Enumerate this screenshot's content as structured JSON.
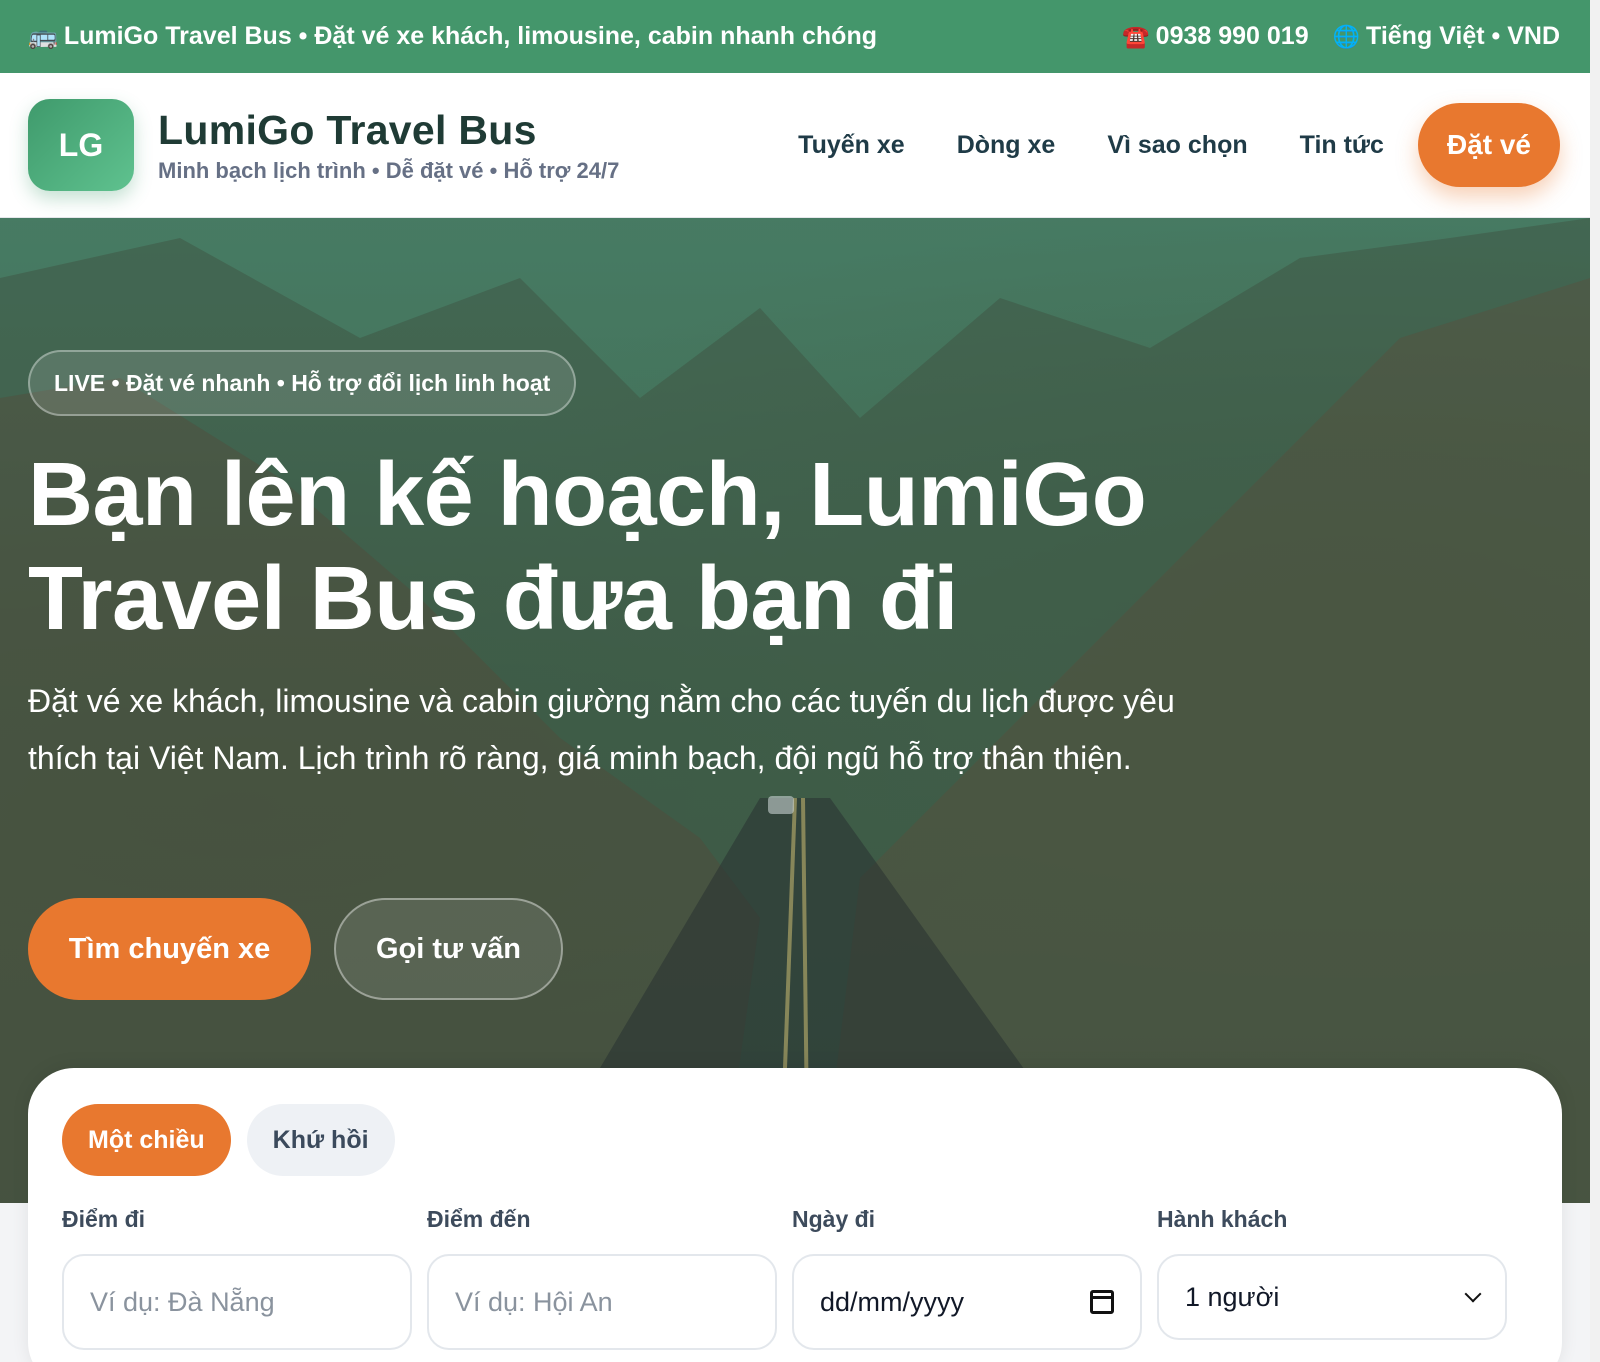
{
  "topbar": {
    "brand_text": "LumiGo Travel Bus • Đặt vé xe khách, limousine, cabin nhanh chóng",
    "bus_icon": "🚌",
    "phone_icon": "☎️",
    "phone": "0938 990 019",
    "globe_icon": "🌐",
    "locale": "Tiếng Việt • VND"
  },
  "header": {
    "logo_text": "LG",
    "brand_name": "LumiGo Travel Bus",
    "tagline": "Minh bạch lịch trình • Dễ đặt vé • Hỗ trợ 24/7",
    "nav": [
      "Tuyến xe",
      "Dòng xe",
      "Vì sao chọn",
      "Tin tức"
    ],
    "cta": "Đặt vé"
  },
  "hero": {
    "badge": "LIVE • Đặt vé nhanh • Hỗ trợ đổi lịch linh hoạt",
    "title": "Bạn lên kế hoạch, LumiGo Travel Bus đưa bạn đi",
    "description": "Đặt vé xe khách, limousine và cabin giường nằm cho các tuyến du lịch được yêu thích tại Việt Nam. Lịch trình rõ ràng, giá minh bạch, đội ngũ hỗ trợ thân thiện.",
    "primary_button": "Tìm chuyến xe",
    "secondary_button": "Gọi tư vấn"
  },
  "booking": {
    "tabs": [
      "Một chiều",
      "Khứ hồi"
    ],
    "from": {
      "label": "Điểm đi",
      "placeholder": "Ví dụ: Đà Nẵng"
    },
    "to": {
      "label": "Điểm đến",
      "placeholder": "Ví dụ: Hội An"
    },
    "date": {
      "label": "Ngày đi",
      "value": "dd/mm/yyyy"
    },
    "passengers": {
      "label": "Hành khách",
      "value": "1 người"
    }
  },
  "colors": {
    "primary_green": "#44966b",
    "accent_orange": "#e8782f"
  }
}
